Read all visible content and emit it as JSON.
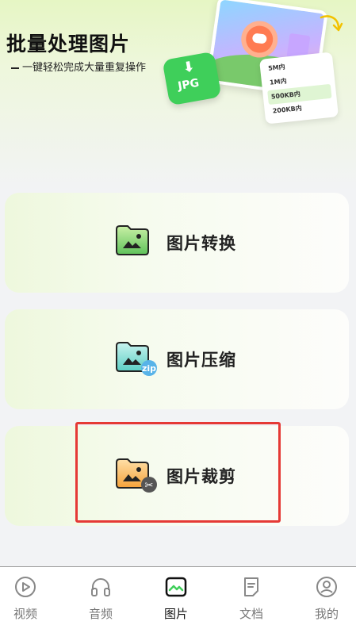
{
  "hero": {
    "title": "批量处理图片",
    "subtitle": "一键轻松完成大量重复操作",
    "badge_text": "JPG",
    "size_options": [
      "5M内",
      "1M内",
      "500KB内",
      "200KB内"
    ],
    "selected_size": "500KB内"
  },
  "features": [
    {
      "label": "图片转换",
      "icon": "image-folder-icon"
    },
    {
      "label": "图片压缩",
      "icon": "image-folder-zip-icon"
    },
    {
      "label": "图片裁剪",
      "icon": "image-folder-scissors-icon"
    }
  ],
  "tabs": [
    {
      "label": "视频",
      "icon": "play-circle-icon",
      "active": false
    },
    {
      "label": "音频",
      "icon": "headphones-icon",
      "active": false
    },
    {
      "label": "图片",
      "icon": "picture-icon",
      "active": true
    },
    {
      "label": "文档",
      "icon": "document-icon",
      "active": false
    },
    {
      "label": "我的",
      "icon": "profile-icon",
      "active": false
    }
  ],
  "colors": {
    "accent_green": "#3fcf5a",
    "highlight_red": "#e53935",
    "background": "#f2f3f5"
  }
}
